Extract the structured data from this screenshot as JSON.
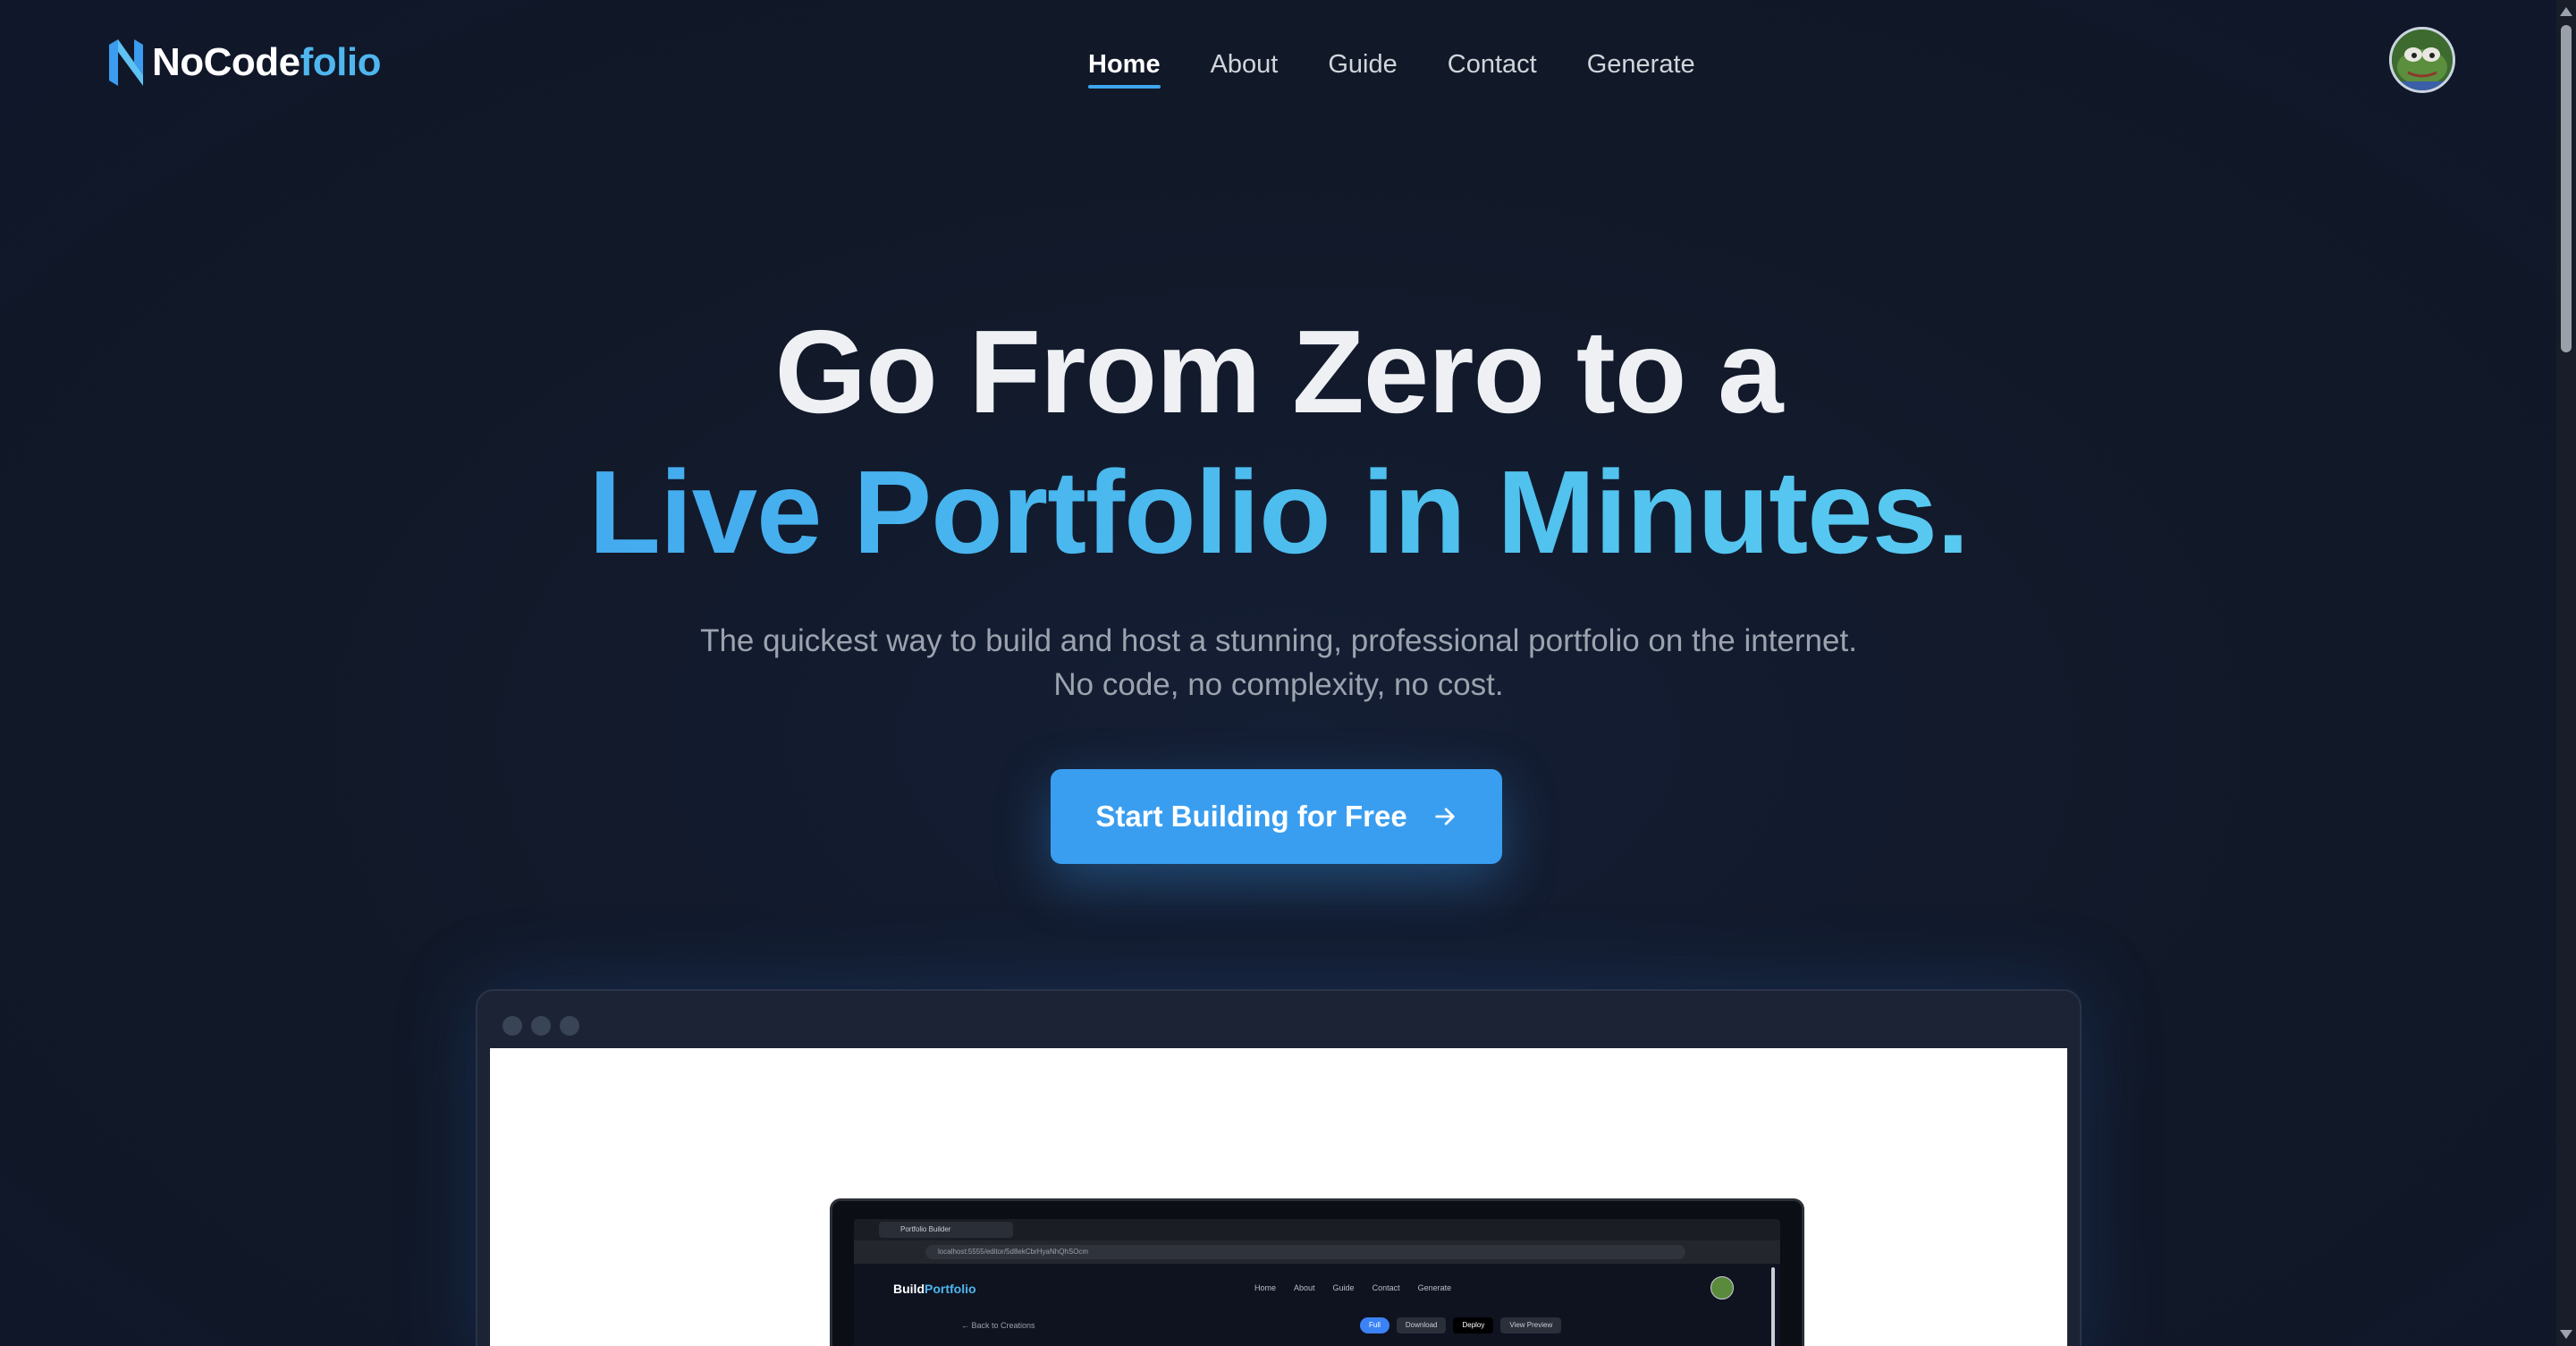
{
  "brand": {
    "name_part1": "NoCode",
    "name_part2": "folio"
  },
  "nav": {
    "items": [
      "Home",
      "About",
      "Guide",
      "Contact",
      "Generate"
    ],
    "active": "Home"
  },
  "hero": {
    "line1": "Go From Zero to a",
    "line2": "Live Portfolio in Minutes.",
    "subtitle_line1": "The quickest way to build and host a stunning, professional portfolio on the internet.",
    "subtitle_line2": "No code, no complexity, no cost.",
    "cta_label": "Start Building for Free"
  },
  "preview": {
    "mini_tab_title": "Portfolio Builder",
    "mini_url": "localhost:5555/editor/5d8ekCbrHyaNhQhSOcm",
    "mini_brand_part1": "Build",
    "mini_brand_part2": "Portfolio",
    "mini_nav": [
      "Home",
      "About",
      "Guide",
      "Contact",
      "Generate"
    ],
    "mini_back": "← Back to Creations",
    "mini_actions": [
      "Full",
      "Download",
      "Deploy",
      "View Preview"
    ]
  },
  "colors": {
    "background": "#111827",
    "accent": "#3a9ef0",
    "accent_light": "#4fb6ee"
  }
}
